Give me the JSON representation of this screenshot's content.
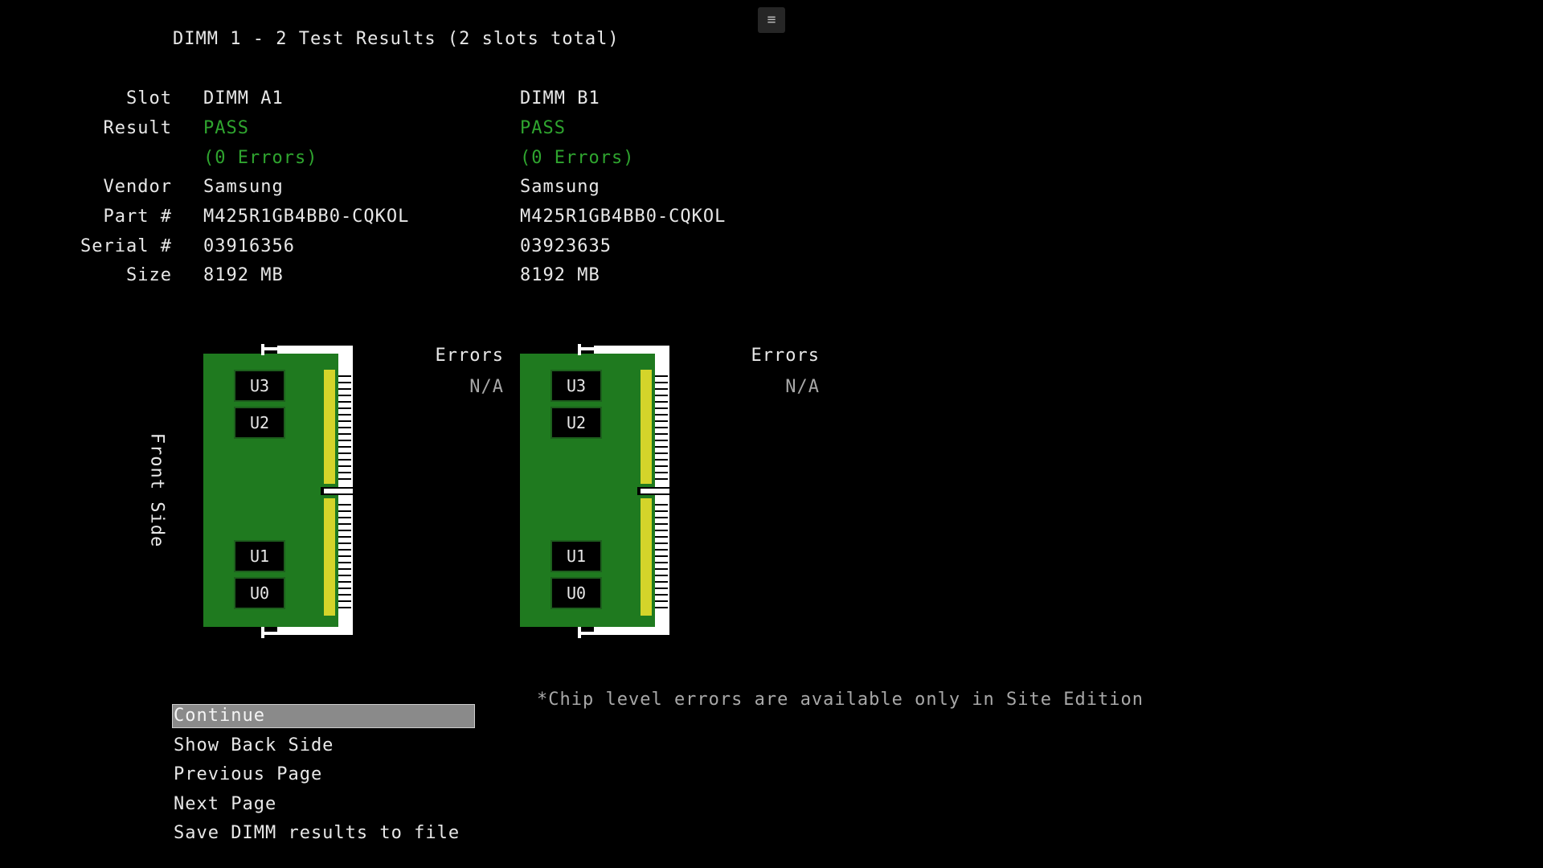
{
  "header": {
    "title": "DIMM 1 - 2 Test Results (2 slots total)",
    "menu_icon": "≡"
  },
  "labels": {
    "slot": "Slot",
    "result": "Result",
    "vendor": "Vendor",
    "part": "Part #",
    "serial": "Serial #",
    "size": "Size"
  },
  "dimms": [
    {
      "slot": "DIMM A1",
      "result": "PASS",
      "errors_text": "(0 Errors)",
      "vendor": "Samsung",
      "part": "M425R1GB4BB0-CQKOL",
      "serial": "03916356",
      "size": "8192 MB",
      "errors_header": "Errors",
      "errors_value": "N/A",
      "chips": [
        "U3",
        "U2",
        "U1",
        "U0"
      ]
    },
    {
      "slot": "DIMM B1",
      "result": "PASS",
      "errors_text": "(0 Errors)",
      "vendor": "Samsung",
      "part": "M425R1GB4BB0-CQKOL",
      "serial": "03923635",
      "size": "8192 MB",
      "errors_header": "Errors",
      "errors_value": "N/A",
      "chips": [
        "U3",
        "U2",
        "U1",
        "U0"
      ]
    }
  ],
  "side_label": "Front Side",
  "note": "*Chip level errors are available only in Site Edition",
  "menu": {
    "items": [
      {
        "label": "Continue",
        "selected": true
      },
      {
        "label": "Show Back Side",
        "selected": false
      },
      {
        "label": "Previous Page",
        "selected": false
      },
      {
        "label": "Next Page",
        "selected": false
      },
      {
        "label": "Save DIMM results to file",
        "selected": false
      }
    ]
  },
  "colors": {
    "background": "#000000",
    "pcb_green": "#1f7a1f",
    "pass_green": "#2fa52f",
    "gold_contacts": "#d4d42a",
    "selection": "#8a8a8a"
  }
}
